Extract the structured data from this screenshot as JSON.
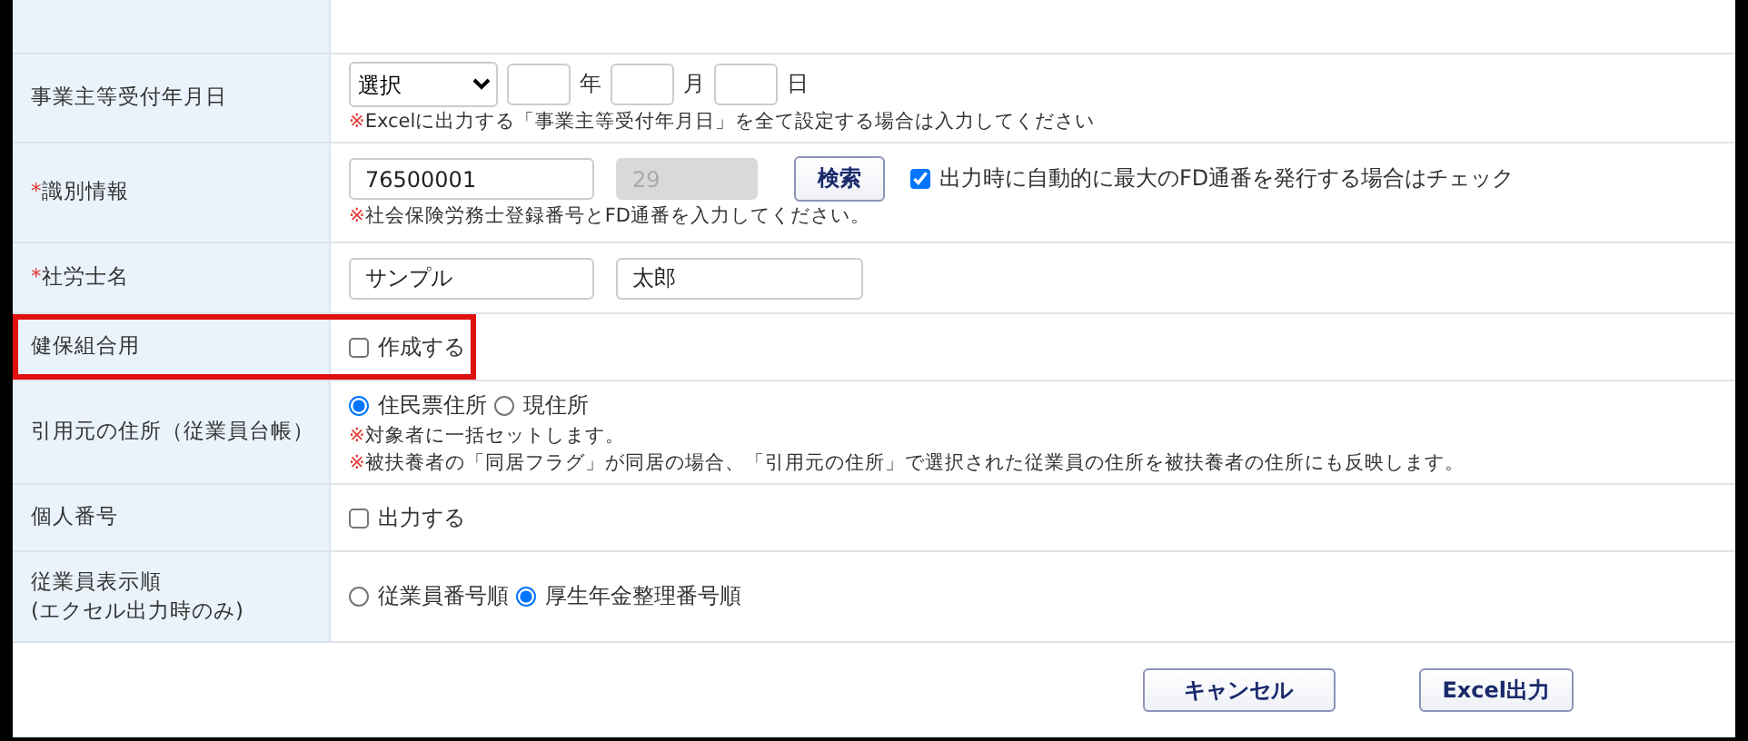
{
  "rows": [
    {
      "kind": "date",
      "label": "事業主等受付年月日",
      "select": {
        "value": "選択"
      },
      "parts": [
        {
          "unit": "年"
        },
        {
          "unit": "月"
        },
        {
          "unit": "日"
        }
      ],
      "notes": [
        {
          "mark": "※",
          "text": "Excelに出力する「事業主等受付年月日」を全て設定する場合は入力してください"
        }
      ]
    },
    {
      "kind": "ident",
      "label": "識別情報",
      "required_mark": "*",
      "number": {
        "value": "76500001"
      },
      "serial": {
        "value": "29",
        "disabled": true
      },
      "button": "検索",
      "check": {
        "label": "出力時に自動的に最大のFD通番を発行する場合はチェック",
        "checked": true
      },
      "notes": [
        {
          "mark": "※",
          "text": "社会保険労務士登録番号とFD通番を入力してください。"
        }
      ]
    },
    {
      "kind": "name",
      "label": "社労士名",
      "required_mark": "*",
      "fields": [
        {
          "value": "サンプル"
        },
        {
          "value": "太郎"
        }
      ]
    },
    {
      "kind": "checkbox",
      "label": "健保組合用",
      "highlighted": true,
      "check": {
        "label": "作成する",
        "checked": false
      }
    },
    {
      "kind": "radio",
      "label": "引用元の住所（従業員台帳）",
      "options": [
        {
          "label": "住民票住所",
          "selected": true
        },
        {
          "label": "現住所",
          "selected": false
        }
      ],
      "notes": [
        {
          "mark": "※",
          "text": "対象者に一括セットします。"
        },
        {
          "mark": "※",
          "text": "被扶養者の「同居フラグ」が同居の場合、「引用元の住所」で選択された従業員の住所を被扶養者の住所にも反映します。"
        }
      ]
    },
    {
      "kind": "checkbox",
      "label": "個人番号",
      "check": {
        "label": "出力する",
        "checked": false
      }
    },
    {
      "kind": "radio",
      "label": "従業員表示順\n(エクセル出力時のみ)",
      "options": [
        {
          "label": "従業員番号順",
          "selected": false
        },
        {
          "label": "厚生年金整理番号順",
          "selected": true
        }
      ]
    }
  ],
  "buttons": [
    "キャンセル",
    "Excel出力"
  ]
}
